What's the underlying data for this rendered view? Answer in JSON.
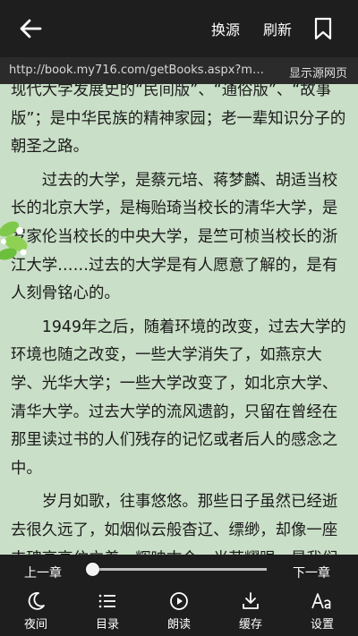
{
  "header": {
    "change_source": "换源",
    "refresh": "刷新"
  },
  "urlbar": {
    "url": "http://book.my716.com/getBooks.aspx?m…",
    "show_source": "显示源网页"
  },
  "content": {
    "paragraphs": [
      "现代大学发展史的“民间版”、“通俗版”、“故事版”；是中华民族的精神家园；老一辈知识分子的朝圣之路。",
      "过去的大学，是蔡元培、蒋梦麟、胡适当校长的北京大学，是梅贻琦当校长的清华大学，是罗家伦当校长的中央大学，是竺可桢当校长的浙江大学……过去的大学是有人愿意了解的，是有人刻骨铭心的。",
      "1949年之后，随着环境的改变，过去大学的环境也随之改变，一些大学消失了，如燕京大学、光华大学；一些大学改变了，如北京大学、清华大学。过去大学的流风遗韵，只留在曾经在那里读过书的人们残存的记忆或者后人的感念之中。",
      "岁月如歌，往事悠悠。那些日子虽然已经逝去很久远了，如烟似云般杳辽、缥缈，却像一座丰碑高高伫立着，辉映古今，光芒耀眼，是我们永远不应该忘记的。"
    ]
  },
  "controls": {
    "prev_chapter": "上一章",
    "next_chapter": "下一章",
    "progress": 0.0,
    "tools": [
      {
        "label": "夜间",
        "icon": "moon-icon"
      },
      {
        "label": "目录",
        "icon": "list-icon"
      },
      {
        "label": "朗读",
        "icon": "play-circle-icon"
      },
      {
        "label": "缓存",
        "icon": "download-icon"
      },
      {
        "label": "设置",
        "icon": "font-settings-icon"
      }
    ]
  },
  "colors": {
    "page_background": "#c9dfc7",
    "bar_background": "#1e1e1e",
    "text": "#1b1b1b"
  }
}
